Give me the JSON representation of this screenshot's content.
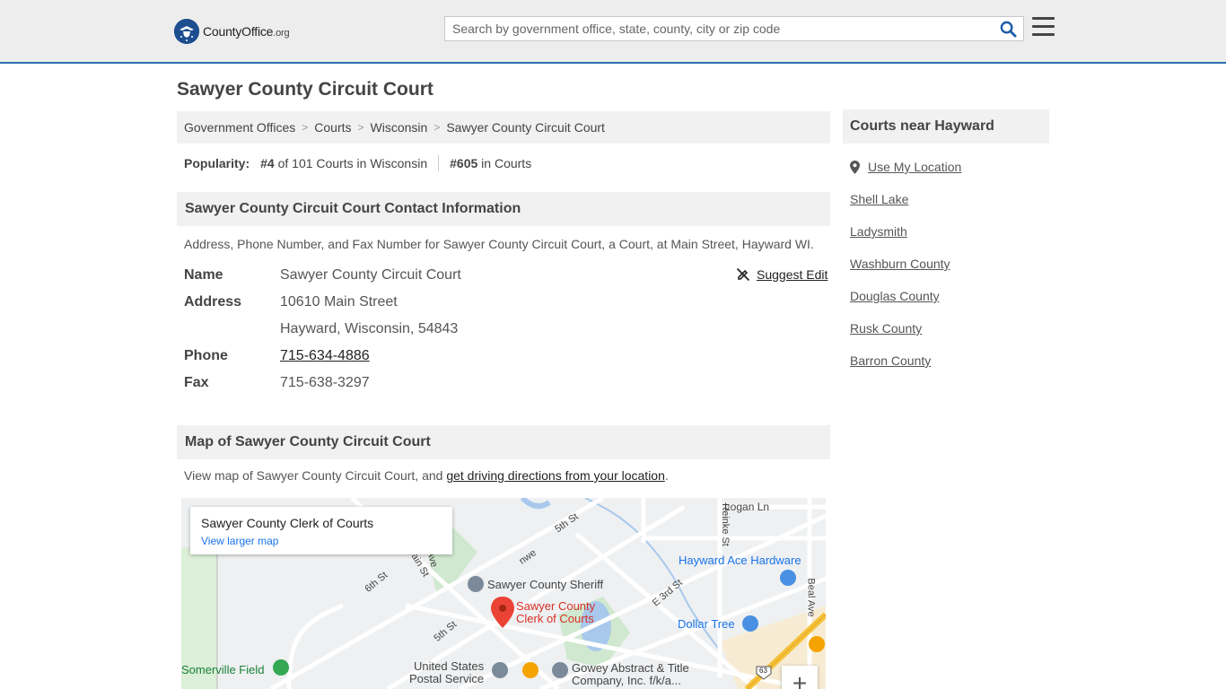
{
  "header": {
    "logo_text_main": "CountyOffice",
    "logo_text_suffix": ".org",
    "search_placeholder": "Search by government office, state, county, city or zip code"
  },
  "page_title": "Sawyer County Circuit Court",
  "breadcrumbs": [
    "Government Offices",
    "Courts",
    "Wisconsin",
    "Sawyer County Circuit Court"
  ],
  "breadcrumb_separator": ">",
  "popularity": {
    "label": "Popularity:",
    "state_rank": "#4",
    "state_text": "of 101 Courts in Wisconsin",
    "national_rank": "#605",
    "national_text": "in Courts"
  },
  "contact": {
    "heading": "Sawyer County Circuit Court Contact Information",
    "description": "Address, Phone Number, and Fax Number for Sawyer County Circuit Court, a Court, at Main Street, Hayward WI.",
    "suggest_edit": "Suggest Edit",
    "fields": {
      "name_label": "Name",
      "name_value": "Sawyer County Circuit Court",
      "address_label": "Address",
      "address_line1": "10610 Main Street",
      "address_line2": "Hayward, Wisconsin, 54843",
      "phone_label": "Phone",
      "phone_value": "715-634-4886",
      "fax_label": "Fax",
      "fax_value": "715-638-3297"
    }
  },
  "map_section": {
    "heading": "Map of Sawyer County Circuit Court",
    "desc_prefix": "View map of Sawyer County Circuit Court, and ",
    "desc_link": "get driving directions from your location",
    "desc_suffix": ".",
    "card_title": "Sawyer County Clerk of Courts",
    "card_link": "View larger map",
    "labels": {
      "logan": "Logan Ln",
      "reinke": "Reinke St",
      "fifth_st_top": "5th St",
      "nwe": "nwe",
      "main_st": "Main St",
      "ave": "Ave",
      "sixth": "6th St",
      "ace": "Hayward Ace Hardware",
      "sheriff": "Sawyer County Sheriff",
      "clerk_l1": "Sawyer County",
      "clerk_l2": "Clerk of Courts",
      "e3rd": "E 3rd St",
      "dollar": "Dollar Tree",
      "beal": "Beal Ave",
      "fifth_st_bottom": "5th St",
      "somerville": "Somerville Field",
      "usps_l1": "United States",
      "usps_l2": "Postal Service",
      "gowey_l1": "Gowey Abstract & Title",
      "gowey_l2": "Company, Inc. f/k/a...",
      "hwy": "63"
    },
    "zoom_in": "+"
  },
  "sidebar": {
    "heading": "Courts near Hayward",
    "use_location": "Use My Location",
    "items": [
      "Shell Lake",
      "Ladysmith",
      "Washburn County",
      "Douglas County",
      "Rusk County",
      "Barron County"
    ]
  }
}
